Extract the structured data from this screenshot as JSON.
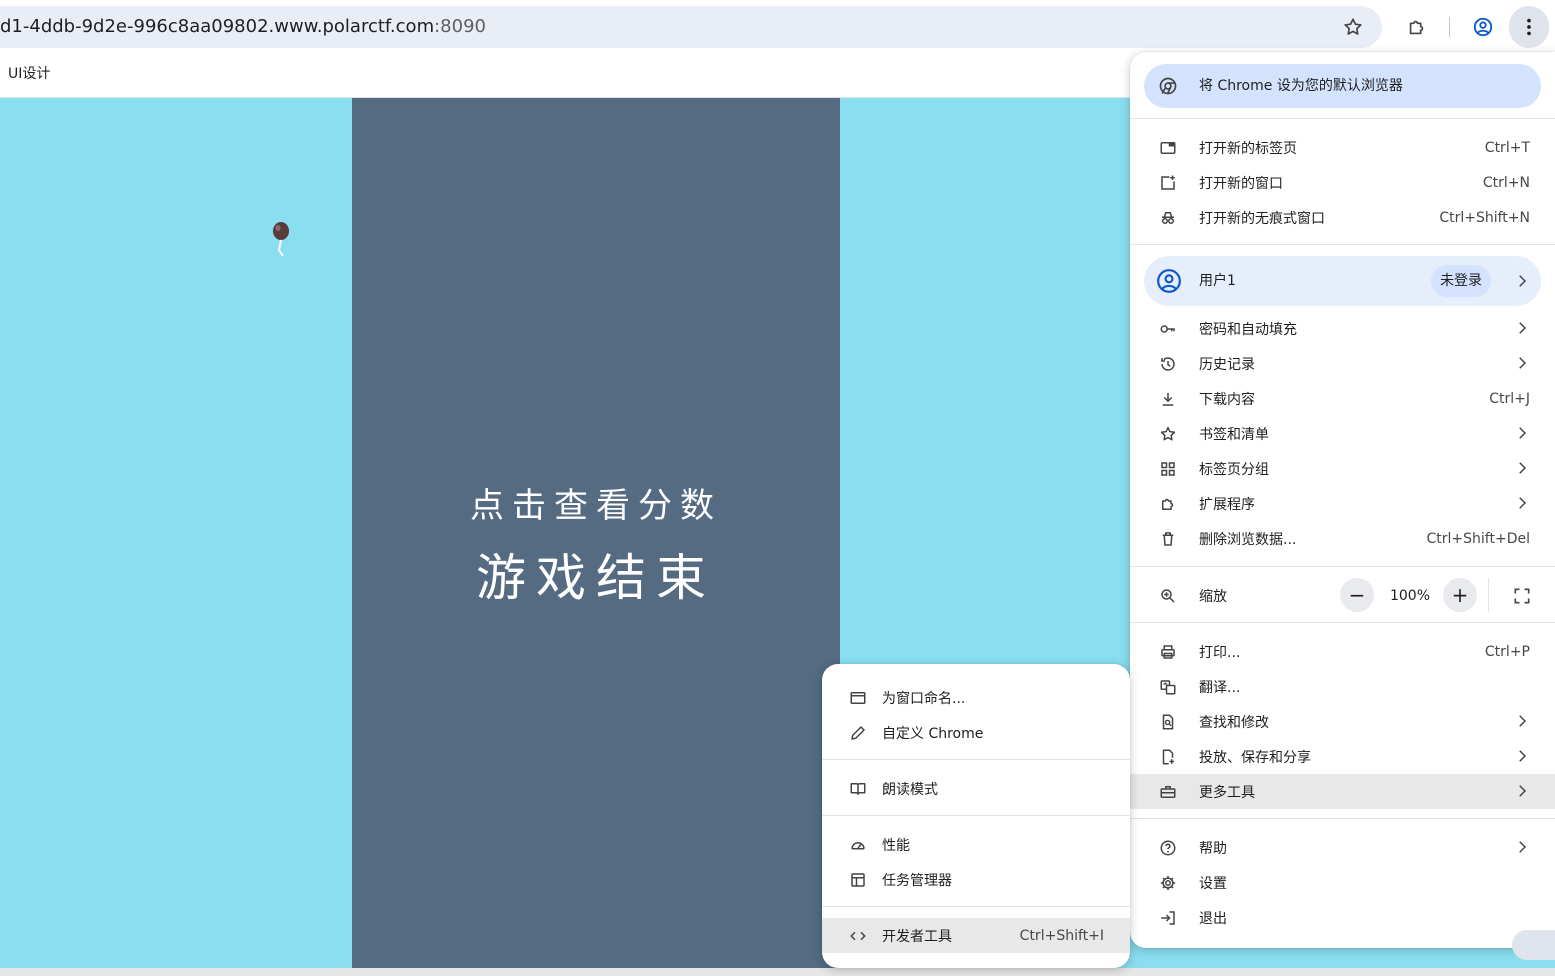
{
  "browser": {
    "url_path": "d1-4ddb-9d2e-996c8aa09802.www.polarctf.com",
    "url_port": ":8090",
    "bookmark": "UI设计",
    "icons": [
      "star-icon",
      "extensions-icon",
      "profile-icon",
      "kebab-menu-icon"
    ]
  },
  "game": {
    "score_link": "点击查看分数",
    "game_over": "游戏结束",
    "colors": {
      "outer": "#89def0",
      "board": "#546b82"
    }
  },
  "menu": {
    "default_banner": "将 Chrome 设为您的默认浏览器",
    "new_tab": {
      "label": "打开新的标签页",
      "shortcut": "Ctrl+T"
    },
    "new_window": {
      "label": "打开新的窗口",
      "shortcut": "Ctrl+N"
    },
    "incognito": {
      "label": "打开新的无痕式窗口",
      "shortcut": "Ctrl+Shift+N"
    },
    "profile": {
      "name": "用户1",
      "status": "未登录"
    },
    "passwords": {
      "label": "密码和自动填充"
    },
    "history": {
      "label": "历史记录"
    },
    "downloads": {
      "label": "下载内容",
      "shortcut": "Ctrl+J"
    },
    "bookmarks": {
      "label": "书签和清单"
    },
    "tab_groups": {
      "label": "标签页分组"
    },
    "extensions": {
      "label": "扩展程序"
    },
    "clear_data": {
      "label": "删除浏览数据...",
      "shortcut": "Ctrl+Shift+Del"
    },
    "zoom": {
      "label": "缩放",
      "minus": "−",
      "value": "100%",
      "plus": "+"
    },
    "print": {
      "label": "打印...",
      "shortcut": "Ctrl+P"
    },
    "translate": {
      "label": "翻译..."
    },
    "find": {
      "label": "查找和修改"
    },
    "cast": {
      "label": "投放、保存和分享"
    },
    "more_tools": {
      "label": "更多工具"
    },
    "help": {
      "label": "帮助"
    },
    "settings": {
      "label": "设置"
    },
    "exit": {
      "label": "退出"
    }
  },
  "submenu": {
    "name_window": {
      "label": "为窗口命名..."
    },
    "customize": {
      "label": "自定义 Chrome"
    },
    "reading_mode": {
      "label": "朗读模式"
    },
    "performance": {
      "label": "性能"
    },
    "task_manager": {
      "label": "任务管理器"
    },
    "devtools": {
      "label": "开发者工具",
      "shortcut": "Ctrl+Shift+I"
    }
  }
}
